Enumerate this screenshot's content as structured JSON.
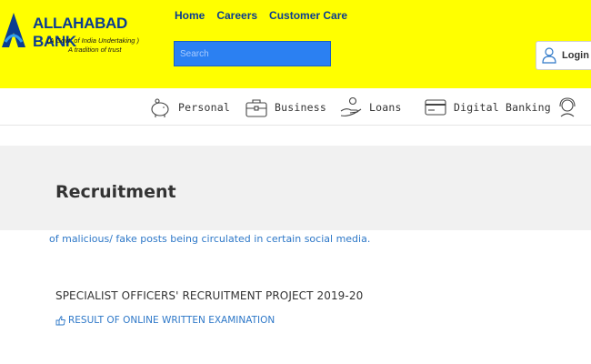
{
  "brand": {
    "name": "ALLAHABAD BANK",
    "subtitle_line1": "(A Govt. of India Undertaking )",
    "subtitle_line2": "A tradition of trust",
    "logo_icon": "allahabad-bank-logo",
    "header_color": "#ffff00",
    "brand_color": "#0b3d91"
  },
  "top_nav": {
    "items": [
      {
        "label": "Home"
      },
      {
        "label": "Careers"
      },
      {
        "label": "Customer Care"
      }
    ]
  },
  "search": {
    "placeholder": "Search",
    "value": ""
  },
  "login": {
    "label": "Login",
    "icon": "user-icon"
  },
  "main_nav": {
    "items": [
      {
        "label": "Personal",
        "icon": "piggy-bank-icon"
      },
      {
        "label": "Business",
        "icon": "briefcase-icon"
      },
      {
        "label": "Loans",
        "icon": "hand-coins-icon"
      },
      {
        "label": "Digital Banking",
        "icon": "card-icon"
      },
      {
        "label": "",
        "icon": "support-agent-icon"
      }
    ]
  },
  "page": {
    "title": "Recruitment",
    "notice": "of malicious/ fake posts being circulated in certain social media.",
    "project_title": "SPECIALIST OFFICERS' RECRUITMENT PROJECT 2019-20",
    "result_link": "RESULT OF ONLINE WRITTEN EXAMINATION",
    "link_icon": "hand-pointing-icon",
    "link_color": "#2e78c8"
  }
}
